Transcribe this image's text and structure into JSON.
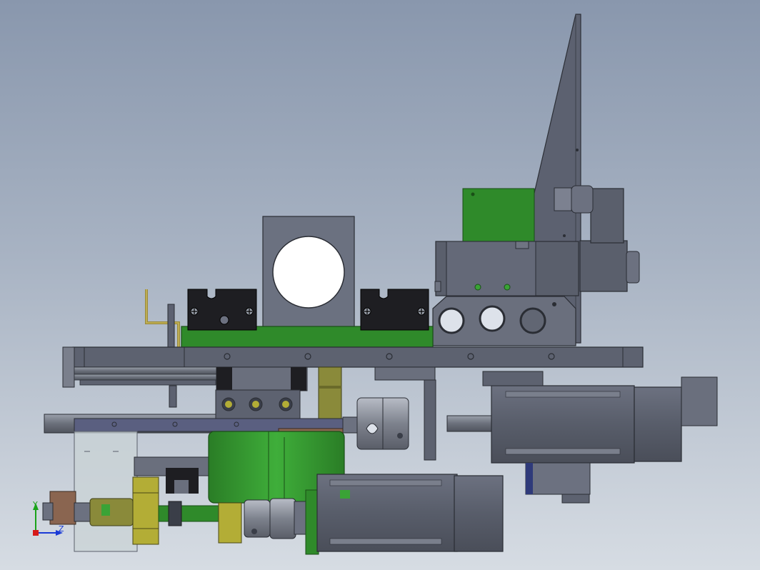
{
  "viewport": {
    "background_top": "#8997ad",
    "background_bottom": "#d6dce3"
  },
  "colors": {
    "steel": "#5f6472",
    "steel_light": "#7a7f8c",
    "steel_dark": "#3f434d",
    "green": "#2f8a2a",
    "green_bright": "#3aa336",
    "olive": "#8a8a3a",
    "yellow_olive": "#b3ad36",
    "black": "#1e1e22",
    "glass": "#c9d3d6",
    "copper": "#8a6550",
    "navy": "#2f3a7a"
  },
  "triad": {
    "y_label": "Y",
    "x_label": "Z",
    "y_color": "#1aa31a",
    "x_color": "#1a3ad6",
    "origin_color": "#d61a1a"
  }
}
